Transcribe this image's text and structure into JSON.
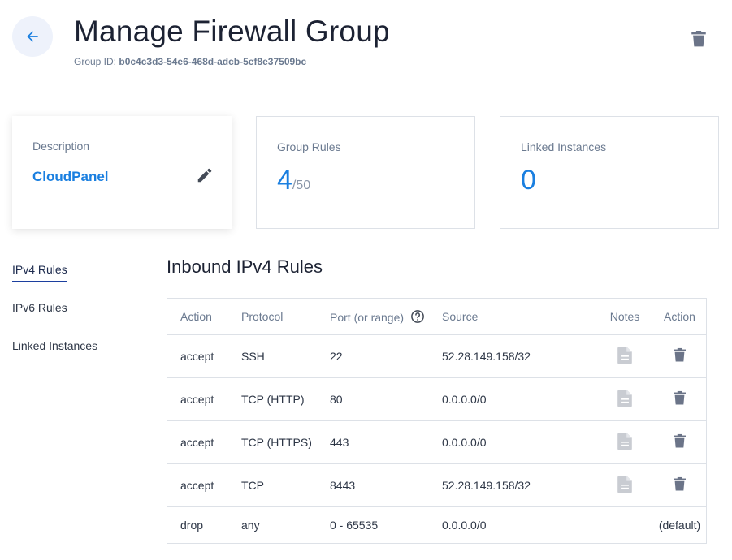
{
  "header": {
    "title": "Manage Firewall Group",
    "group_id_label": "Group ID:",
    "group_id": "b0c4c3d3-54e6-468d-adcb-5ef8e37509bc"
  },
  "cards": {
    "description": {
      "label": "Description",
      "value": "CloudPanel"
    },
    "group_rules": {
      "label": "Group Rules",
      "count": "4",
      "max": "/50"
    },
    "linked_instances": {
      "label": "Linked Instances",
      "count": "0"
    }
  },
  "sidebar": {
    "items": [
      {
        "label": "IPv4 Rules",
        "active": true
      },
      {
        "label": "IPv6 Rules",
        "active": false
      },
      {
        "label": "Linked Instances",
        "active": false
      }
    ]
  },
  "section": {
    "title": "Inbound IPv4 Rules"
  },
  "table": {
    "headers": {
      "action": "Action",
      "protocol": "Protocol",
      "port": "Port (or range)",
      "source": "Source",
      "notes": "Notes",
      "delete": "Action"
    },
    "rows": [
      {
        "action": "accept",
        "protocol": "SSH",
        "port": "22",
        "source": "52.28.149.158/32"
      },
      {
        "action": "accept",
        "protocol": "TCP (HTTP)",
        "port": "80",
        "source": "0.0.0.0/0"
      },
      {
        "action": "accept",
        "protocol": "TCP (HTTPS)",
        "port": "443",
        "source": "0.0.0.0/0"
      },
      {
        "action": "accept",
        "protocol": "TCP",
        "port": "8443",
        "source": "52.28.149.158/32"
      },
      {
        "action": "drop",
        "protocol": "any",
        "port": "0 - 65535",
        "source": "0.0.0.0/0",
        "default_label": "(default)"
      }
    ]
  },
  "icons": {
    "back": "arrow-left-icon",
    "delete": "trash-icon",
    "edit": "pencil-icon",
    "help": "question-circle-icon",
    "notes": "document-icon"
  },
  "colors": {
    "accent": "#1a7fe0",
    "back_button_bg": "#eef2fb",
    "icon_gray": "#6b7488"
  }
}
